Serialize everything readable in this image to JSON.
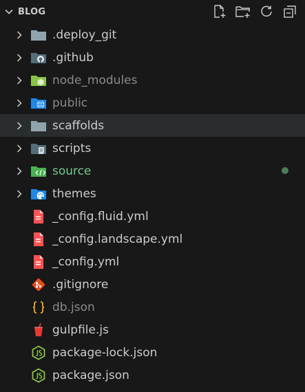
{
  "header": {
    "title": "BLOG",
    "actions": [
      {
        "name": "new-file",
        "icon": "new-file-icon"
      },
      {
        "name": "new-folder",
        "icon": "new-folder-icon"
      },
      {
        "name": "refresh",
        "icon": "refresh-icon"
      },
      {
        "name": "collapse-all",
        "icon": "collapse-all-icon"
      }
    ]
  },
  "colors": {
    "background": "#181818",
    "text": "#cccccc",
    "dim_text": "#8b8b8b",
    "git_added": "#73c991",
    "selected_row": "#2a2d2e",
    "modified_dot": "#4e7c59"
  },
  "items": [
    {
      "label": ".deploy_git",
      "type": "folder",
      "icon": "folder-icon",
      "dim": false
    },
    {
      "label": ".github",
      "type": "folder",
      "icon": "github-folder-icon",
      "dim": false
    },
    {
      "label": "node_modules",
      "type": "folder",
      "icon": "node-modules-folder-icon",
      "dim": true
    },
    {
      "label": "public",
      "type": "folder",
      "icon": "public-folder-icon",
      "dim": true
    },
    {
      "label": "scaffolds",
      "type": "folder",
      "icon": "folder-icon",
      "dim": false,
      "selected": true
    },
    {
      "label": "scripts",
      "type": "folder",
      "icon": "scripts-folder-icon",
      "dim": false
    },
    {
      "label": "source",
      "type": "folder",
      "icon": "source-folder-icon",
      "status": "modified",
      "dim": false
    },
    {
      "label": "themes",
      "type": "folder",
      "icon": "themes-folder-icon",
      "dim": false
    },
    {
      "label": "_config.fluid.yml",
      "type": "file",
      "icon": "yaml-file-icon",
      "dim": false
    },
    {
      "label": "_config.landscape.yml",
      "type": "file",
      "icon": "yaml-file-icon",
      "dim": false
    },
    {
      "label": "_config.yml",
      "type": "file",
      "icon": "yaml-file-icon",
      "dim": false
    },
    {
      "label": ".gitignore",
      "type": "file",
      "icon": "git-file-icon",
      "dim": false
    },
    {
      "label": "db.json",
      "type": "file",
      "icon": "json-file-icon",
      "dim": true
    },
    {
      "label": "gulpfile.js",
      "type": "file",
      "icon": "gulp-file-icon",
      "dim": false
    },
    {
      "label": "package-lock.json",
      "type": "file",
      "icon": "nodejs-file-icon",
      "dim": false
    },
    {
      "label": "package.json",
      "type": "file",
      "icon": "nodejs-file-icon",
      "dim": false
    }
  ]
}
